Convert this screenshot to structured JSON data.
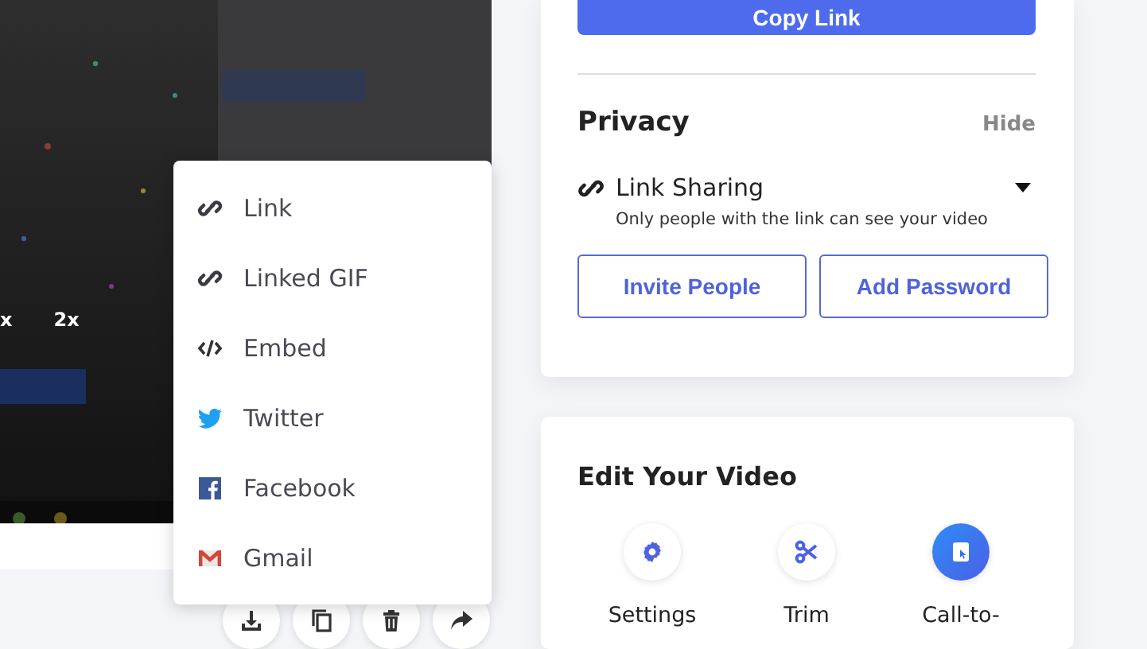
{
  "video": {
    "speed_options": [
      "x",
      "2x"
    ]
  },
  "share_menu": {
    "items": [
      {
        "kind": "link",
        "label": "Link"
      },
      {
        "kind": "link",
        "label": "Linked GIF"
      },
      {
        "kind": "embed",
        "label": "Embed"
      },
      {
        "kind": "twitter",
        "label": "Twitter"
      },
      {
        "kind": "facebook",
        "label": "Facebook"
      },
      {
        "kind": "gmail",
        "label": "Gmail"
      }
    ]
  },
  "video_actions": [
    {
      "kind": "download"
    },
    {
      "kind": "copy"
    },
    {
      "kind": "delete"
    },
    {
      "kind": "share"
    }
  ],
  "share_panel": {
    "copy_button": "Copy Link",
    "privacy": {
      "title": "Privacy",
      "toggle": "Hide",
      "link_sharing": {
        "label": "Link Sharing",
        "description": "Only people with the link can see your video"
      },
      "buttons": [
        "Invite People",
        "Add Password"
      ]
    }
  },
  "edit_panel": {
    "title": "Edit Your Video",
    "tools": [
      {
        "kind": "settings",
        "label": "Settings",
        "highlighted": false
      },
      {
        "kind": "trim",
        "label": "Trim",
        "highlighted": false
      },
      {
        "kind": "cta",
        "label": "Call-to-",
        "highlighted": true
      }
    ]
  }
}
